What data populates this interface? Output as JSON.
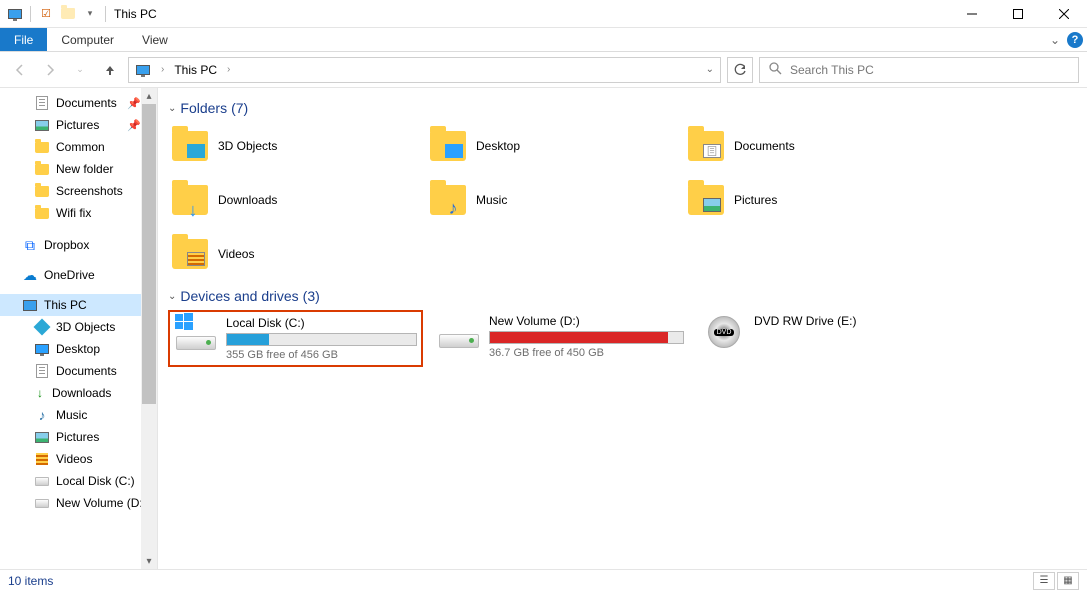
{
  "window": {
    "title": "This PC"
  },
  "ribbon": {
    "tabs": {
      "file": "File",
      "computer": "Computer",
      "view": "View"
    }
  },
  "address": {
    "crumb": "This PC"
  },
  "search": {
    "placeholder": "Search This PC"
  },
  "nav": {
    "documents": "Documents",
    "pictures": "Pictures",
    "common": "Common",
    "newfolder": "New folder",
    "screenshots": "Screenshots",
    "wififix": "Wifi fix",
    "dropbox": "Dropbox",
    "onedrive": "OneDrive",
    "thispc": "This PC",
    "threed": "3D Objects",
    "desktop": "Desktop",
    "documents2": "Documents",
    "downloads": "Downloads",
    "music": "Music",
    "pictures2": "Pictures",
    "videos": "Videos",
    "localdisk": "Local Disk (C:)",
    "newvolume": "New Volume (D:)"
  },
  "groups": {
    "folders": {
      "label": "Folders",
      "count": "(7)"
    },
    "drives": {
      "label": "Devices and drives",
      "count": "(3)"
    }
  },
  "folders": {
    "threed": "3D Objects",
    "desktop": "Desktop",
    "documents": "Documents",
    "downloads": "Downloads",
    "music": "Music",
    "pictures": "Pictures",
    "videos": "Videos"
  },
  "drives": {
    "c": {
      "name": "Local Disk (C:)",
      "free": "355 GB free of 456 GB",
      "pct": 22
    },
    "d": {
      "name": "New Volume (D:)",
      "free": "36.7 GB free of 450 GB",
      "pct": 92
    },
    "e": {
      "name": "DVD RW Drive (E:)"
    }
  },
  "status": {
    "items": "10 items"
  }
}
